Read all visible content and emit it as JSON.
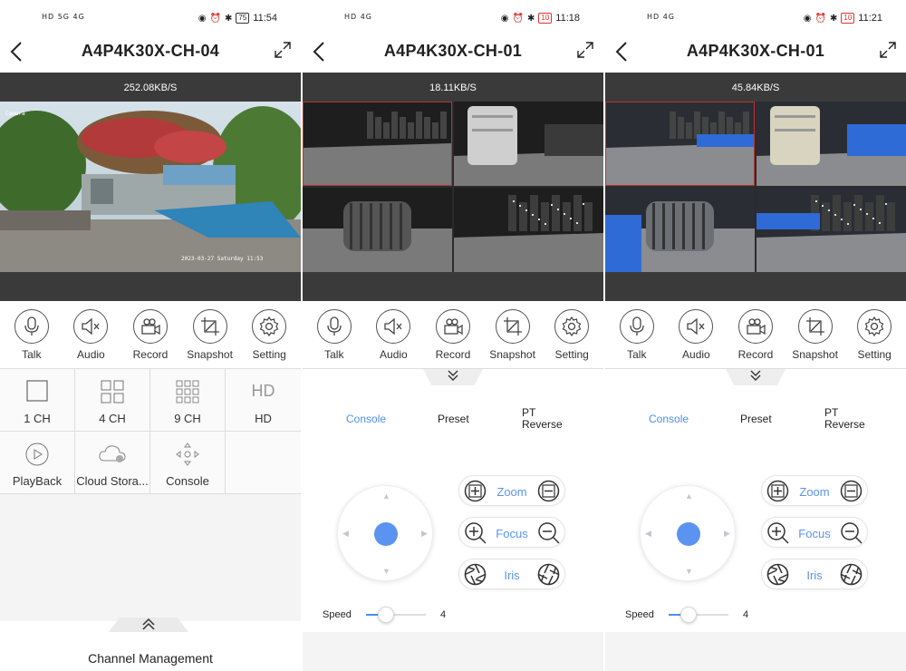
{
  "screens": [
    {
      "status": {
        "left": "HD 5G 4G",
        "time": "11:54",
        "battery": "75",
        "battery_low": false
      },
      "title": "A4P4K30X-CH-04",
      "rate": "252.08KB/S",
      "view": "single",
      "tools": [
        "Talk",
        "Audio",
        "Record",
        "Snapshot",
        "Setting"
      ],
      "grid": [
        {
          "label": "1 CH",
          "icon": "single-square-icon"
        },
        {
          "label": "4 CH",
          "icon": "four-grid-icon"
        },
        {
          "label": "9 CH",
          "icon": "nine-grid-icon"
        },
        {
          "label": "HD",
          "icon": "hd-text-icon"
        },
        {
          "label": "PlayBack",
          "icon": "play-circle-icon"
        },
        {
          "label": "Cloud Stora...",
          "icon": "cloud-icon"
        },
        {
          "label": "Console",
          "icon": "dpad-icon"
        }
      ],
      "hd_icon_text": "HD",
      "channel_label": "Channel Management"
    },
    {
      "status": {
        "left": "HD 4G",
        "time": "11:18",
        "battery": "10",
        "battery_low": true
      },
      "title": "A4P4K30X-CH-01",
      "rate": "18.11KB/S",
      "view": "quad-night",
      "tools": [
        "Talk",
        "Audio",
        "Record",
        "Snapshot",
        "Setting"
      ],
      "ptz": {
        "tabs": [
          "Console",
          "Preset",
          "PT Reverse"
        ],
        "active_tab": "Console",
        "pills": [
          "Zoom",
          "Focus",
          "Iris"
        ],
        "speed_label": "Speed",
        "speed_value": "4",
        "speed_fraction": 0.33
      }
    },
    {
      "status": {
        "left": "HD 4G",
        "time": "11:21",
        "battery": "10",
        "battery_low": true
      },
      "title": "A4P4K30X-CH-01",
      "rate": "45.84KB/S",
      "view": "quad-color",
      "tools": [
        "Talk",
        "Audio",
        "Record",
        "Snapshot",
        "Setting"
      ],
      "ptz": {
        "tabs": [
          "Console",
          "Preset",
          "PT Reverse"
        ],
        "active_tab": "Console",
        "pills": [
          "Zoom",
          "Focus",
          "Iris"
        ],
        "speed_label": "Speed",
        "speed_value": "4",
        "speed_fraction": 0.33
      }
    }
  ],
  "overlays": {
    "cam_name": "Camera",
    "cam_timestamp": "2023-03-27 Saturday 11:53"
  },
  "colors": {
    "accent": "#4a8fe7",
    "knob": "#5b94f0",
    "battery_low": "#d33333",
    "bar": "#3a3a3a"
  }
}
